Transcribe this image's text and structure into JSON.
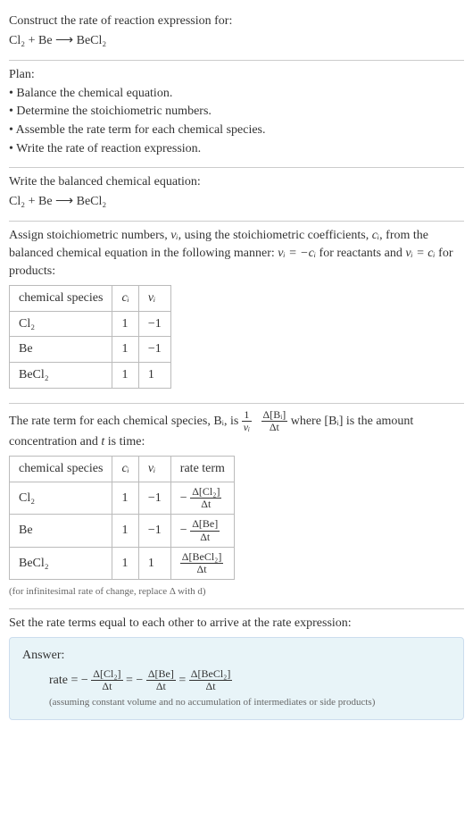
{
  "header": {
    "prompt": "Construct the rate of reaction expression for:",
    "equation": "Cl₂ + Be ⟶ BeCl₂"
  },
  "plan": {
    "title": "Plan:",
    "items": [
      "• Balance the chemical equation.",
      "• Determine the stoichiometric numbers.",
      "• Assemble the rate term for each chemical species.",
      "• Write the rate of reaction expression."
    ]
  },
  "balanced": {
    "title": "Write the balanced chemical equation:",
    "equation": "Cl₂ + Be ⟶ BeCl₂"
  },
  "stoich": {
    "intro_a": "Assign stoichiometric numbers, ",
    "intro_b": ", using the stoichiometric coefficients, ",
    "intro_c": ", from the balanced chemical equation in the following manner: ",
    "intro_d": " for reactants and ",
    "intro_e": " for products:",
    "nu_i": "νᵢ",
    "c_i": "cᵢ",
    "rel_react": "νᵢ = −cᵢ",
    "rel_prod": "νᵢ = cᵢ",
    "headers": [
      "chemical species",
      "cᵢ",
      "νᵢ"
    ],
    "rows": [
      {
        "sp": "Cl₂",
        "c": "1",
        "nu": "−1"
      },
      {
        "sp": "Be",
        "c": "1",
        "nu": "−1"
      },
      {
        "sp": "BeCl₂",
        "c": "1",
        "nu": "1"
      }
    ]
  },
  "rateterm": {
    "pre": "The rate term for each chemical species, Bᵢ, is ",
    "frac1_num": "1",
    "frac1_den": "νᵢ",
    "frac2_num": "Δ[Bᵢ]",
    "frac2_den": "Δt",
    "post_a": " where [Bᵢ] is the amount concentration and ",
    "t": "t",
    "post_b": " is time:",
    "headers": [
      "chemical species",
      "cᵢ",
      "νᵢ",
      "rate term"
    ],
    "rows": [
      {
        "sp": "Cl₂",
        "c": "1",
        "nu": "−1",
        "rt_sign": "−",
        "rt_num": "Δ[Cl₂]",
        "rt_den": "Δt"
      },
      {
        "sp": "Be",
        "c": "1",
        "nu": "−1",
        "rt_sign": "−",
        "rt_num": "Δ[Be]",
        "rt_den": "Δt"
      },
      {
        "sp": "BeCl₂",
        "c": "1",
        "nu": "1",
        "rt_sign": "",
        "rt_num": "Δ[BeCl₂]",
        "rt_den": "Δt"
      }
    ],
    "note": "(for infinitesimal rate of change, replace Δ with d)"
  },
  "final": {
    "title": "Set the rate terms equal to each other to arrive at the rate expression:"
  },
  "answer": {
    "label": "Answer:",
    "rate_label": "rate = ",
    "t1_sign": "−",
    "t1_num": "Δ[Cl₂]",
    "t1_den": "Δt",
    "eq": " = ",
    "t2_sign": "−",
    "t2_num": "Δ[Be]",
    "t2_den": "Δt",
    "t3_sign": "",
    "t3_num": "Δ[BeCl₂]",
    "t3_den": "Δt",
    "note": "(assuming constant volume and no accumulation of intermediates or side products)"
  }
}
